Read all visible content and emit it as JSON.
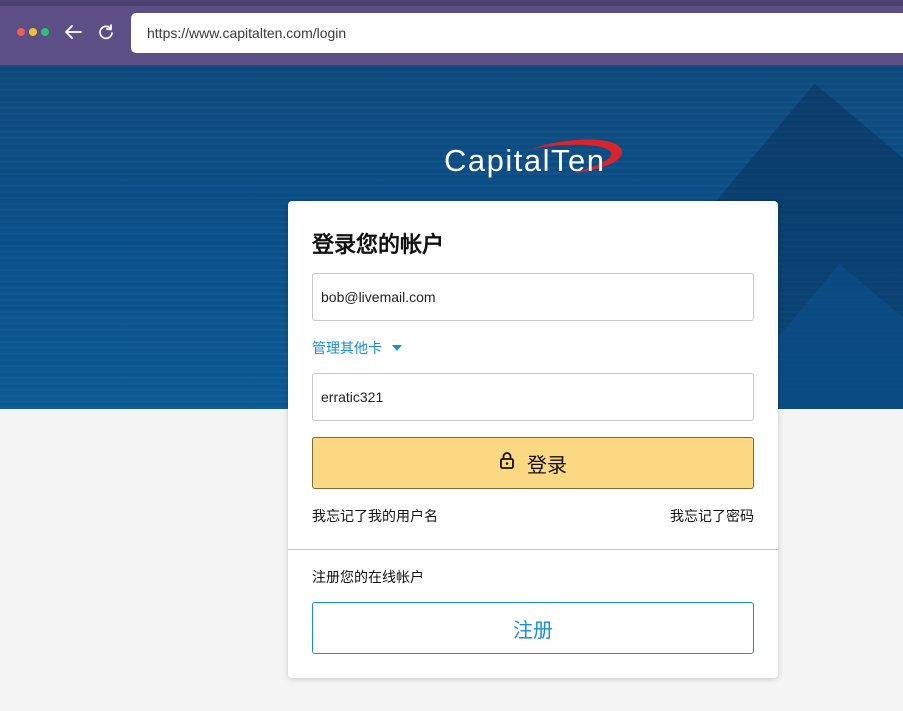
{
  "browser": {
    "url": "https://www.capitalten.com/login",
    "icons": [
      "window-dots",
      "back-arrow-icon",
      "reload-icon"
    ]
  },
  "brand": {
    "name": "CapitalTen",
    "swoosh_color": "#d9232e"
  },
  "login": {
    "title": "登录您的帐户",
    "username_value": "bob@livemail.com",
    "manage_cards_label": "管理其他卡",
    "password_value": "erratic321",
    "submit_label": "登录",
    "submit_icon": "lock-icon",
    "forgot_username": "我忘记了我的用户名",
    "forgot_password": "我忘记了密码"
  },
  "register": {
    "prompt": "注册您的在线帐户",
    "button_label": "注册"
  },
  "colors": {
    "browser_bar": "#5b4f85",
    "hero": "#0a4f88",
    "login_button": "#fcd882",
    "link_blue": "#1b8ed0"
  }
}
